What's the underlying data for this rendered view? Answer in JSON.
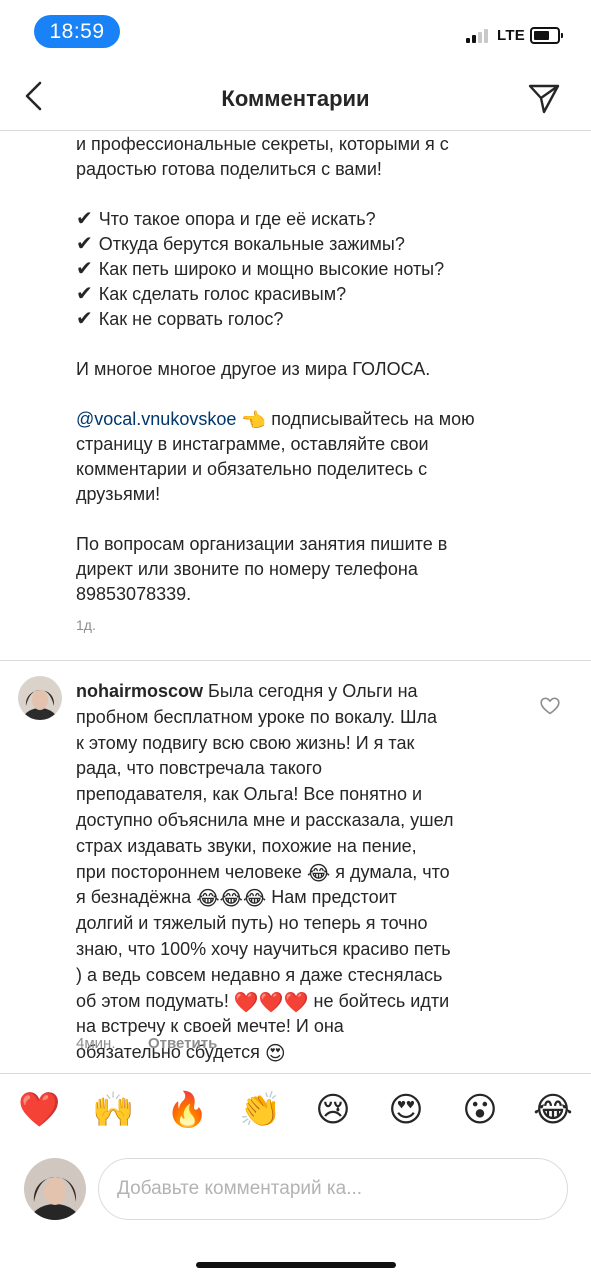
{
  "status_bar": {
    "time": "18:59",
    "network": "LTE"
  },
  "header": {
    "title": "Комментарии"
  },
  "caption": {
    "intro_line1": "и профессиональные секреты, которыми я с",
    "intro_line2": "радостью готова поделиться с вами!",
    "check_glyph": "✔",
    "checklist": [
      "Что такое опора и где её искать?",
      "Откуда берутся вокальные зажимы?",
      "Как петь широко и мощно высокие ноты?",
      "Как сделать голос красивым?",
      "Как не сорвать голос?"
    ],
    "more_text": "И многое многое другое из мира ГОЛОСА.",
    "mention": "@vocal.vnukovskoe",
    "pointing_emoji": "👈",
    "follow_text_1": " подписывайтесь на мою",
    "follow_text_2": "страницу в инстаграмме, оставляйте свои",
    "follow_text_3": "комментарии и обязательно поделитесь с",
    "follow_text_4": "друзьями!",
    "contact_line1": "По вопросам организации занятия пишите в",
    "contact_line2": "директ или звоните по номеру телефона",
    "contact_line3": "89853078339.",
    "time_ago": "1д."
  },
  "comment": {
    "username": "nohairmoscow",
    "lines": [
      " Была сегодня у Ольги на",
      "пробном бесплатном уроке по вокалу. Шла",
      "к этому подвигу всю свою жизнь! И я так",
      "рада, что повстречала такого",
      "преподавателя, как Ольга! Все понятно и",
      "доступно объяснила мне и рассказала, ушел",
      "страх издавать звуки, похожие на пение,",
      "при постороннем человеке "
    ],
    "line8_emoji": "😂",
    "line8_tail": " я думала, что",
    "line9_head": "я безнадёжна ",
    "line9_emojis": "😂😂😂",
    "line9_tail": " Нам предстоит",
    "line10": "долгий и тяжелый путь) но теперь я точно",
    "line11": "знаю, что 100% хочу научиться красиво петь",
    "line12": ") а ведь совсем недавно я даже стеснялась",
    "line13_head": "об этом подумать! ",
    "line13_emojis": "❤️❤️❤️",
    "line13_tail": " не бойтесь идти",
    "line14": "на встречу к своей мечте! И она",
    "line15_head": "обязательно сбудется ",
    "line15_emoji": "😍",
    "time_ago": "4мин.",
    "reply_label": "Ответить"
  },
  "quick_reactions": [
    {
      "emoji": "❤️",
      "icon": "red-heart-icon"
    },
    {
      "emoji": "🙌",
      "icon": "raising-hands-icon"
    },
    {
      "emoji": "🔥",
      "icon": "fire-icon"
    },
    {
      "emoji": "👏",
      "icon": "clapping-hands-icon"
    },
    {
      "emoji": "😢",
      "icon": "crying-face-icon"
    },
    {
      "emoji": "😍",
      "icon": "heart-eyes-icon"
    },
    {
      "emoji": "😮",
      "icon": "surprised-face-icon"
    },
    {
      "emoji": "😂",
      "icon": "tears-of-joy-icon"
    }
  ],
  "composer": {
    "placeholder": "Добавьте комментарий ка..."
  },
  "colors": {
    "accent_blue": "#1a82f7",
    "mention": "#00376b",
    "secondary_text": "#8e8e8e"
  }
}
